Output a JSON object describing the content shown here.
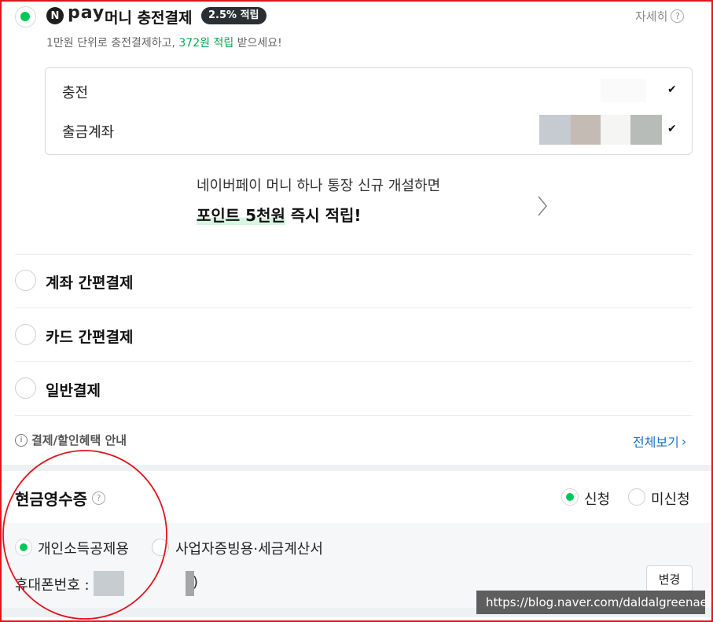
{
  "npay": {
    "logo_letter": "N",
    "pay_text": "pay",
    "title": "머니 충전결제",
    "badge": "2.5% 적립",
    "detail_link": "자세히",
    "desc_prefix": "1만원 단위로 충전결제하고, ",
    "desc_highlight": "372원 적립",
    "desc_suffix": " 받으세요!",
    "charge_label": "충전",
    "account_label": "출금계좌",
    "promo_line1": "네이버페이 머니 하나 통장 신규 개설하면",
    "promo_line2_hl": "포인트 5천원",
    "promo_line2_rest": " 즉시 적립!"
  },
  "options": [
    {
      "label": "계좌 간편결제"
    },
    {
      "label": "카드 간편결제"
    },
    {
      "label": "일반결제"
    }
  ],
  "benefit": {
    "label": "결제/할인혜택 안내",
    "view_all": "전체보기"
  },
  "receipt": {
    "title": "현금영수증",
    "apply": "신청",
    "no_apply": "미신청",
    "personal": "개인소득공제용",
    "business": "사업자증빙용·세금계산서",
    "phone_label": "휴대폰번호 :",
    "phone_tail": ")",
    "change_button": "변경"
  },
  "watermark": "https://blog.naver.com/daldalgreenae",
  "colors": {
    "accent_green": "#03c75a",
    "link_blue": "#1a73c8",
    "annotation_red": "#e0141e"
  }
}
